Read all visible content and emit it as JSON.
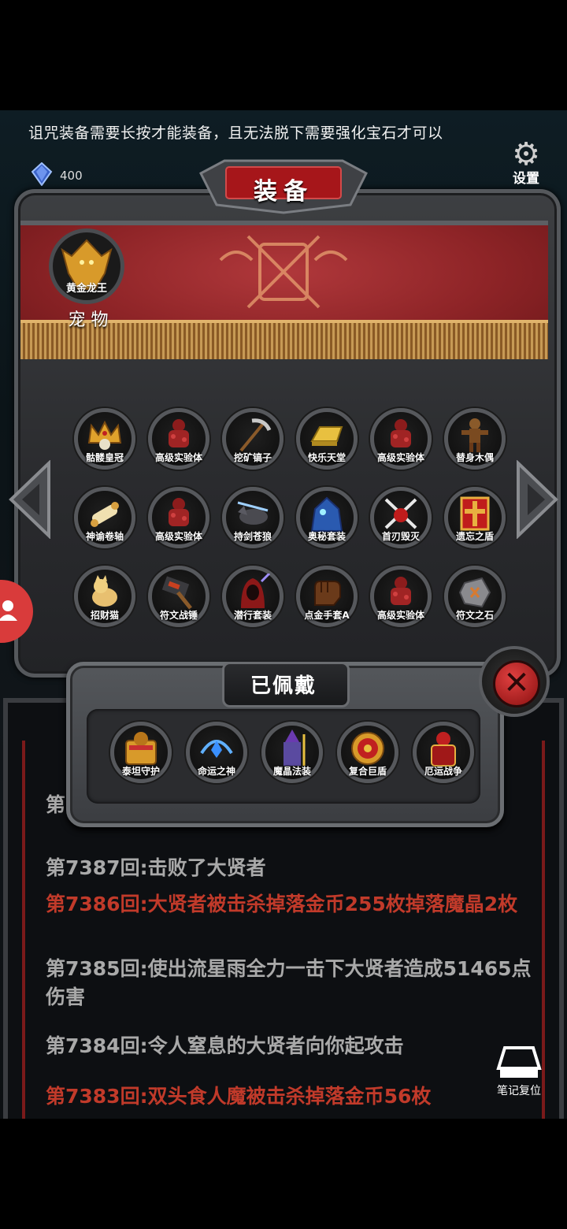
{
  "tip": "诅咒装备需要长按才能装备，且无法脱下需要强化宝石才可以",
  "gem_count": "400",
  "settings_label": "设置",
  "panel_title": "装备",
  "pet": {
    "name": "黄金龙王",
    "title": "宠 物"
  },
  "items": [
    {
      "name": "骷髅皇冠",
      "icon": "crown-icon"
    },
    {
      "name": "高级实验体",
      "icon": "golem-icon"
    },
    {
      "name": "挖矿镐子",
      "icon": "pickaxe-icon"
    },
    {
      "name": "快乐天堂",
      "icon": "gold-bar-icon"
    },
    {
      "name": "高级实验体",
      "icon": "golem-icon"
    },
    {
      "name": "替身木偶",
      "icon": "puppet-icon"
    },
    {
      "name": "神谕卷轴",
      "icon": "scroll-icon"
    },
    {
      "name": "高级实验体",
      "icon": "golem-icon"
    },
    {
      "name": "持剑苍狼",
      "icon": "wolf-icon"
    },
    {
      "name": "奥秘套装",
      "icon": "blue-robe-icon"
    },
    {
      "name": "首刃毁灭",
      "icon": "crossed-blades-icon"
    },
    {
      "name": "遗忘之盾",
      "icon": "red-shield-icon"
    },
    {
      "name": "招财猫",
      "icon": "cat-icon"
    },
    {
      "name": "符文战锤",
      "icon": "hammer-icon"
    },
    {
      "name": "潜行套装",
      "icon": "hood-icon"
    },
    {
      "name": "点金手套A",
      "icon": "glove-icon"
    },
    {
      "name": "高级实验体",
      "icon": "golem-icon"
    },
    {
      "name": "符文之石",
      "icon": "rune-stone-icon"
    }
  ],
  "equipped_title": "已佩戴",
  "equipped": [
    {
      "name": "泰坦守护",
      "icon": "titan-armor-icon"
    },
    {
      "name": "命运之神",
      "icon": "fate-amulet-icon"
    },
    {
      "name": "魔晶法装",
      "icon": "wizard-icon"
    },
    {
      "name": "复合巨盾",
      "icon": "round-shield-icon"
    },
    {
      "name": "厄运战争",
      "icon": "red-knight-icon"
    }
  ],
  "log_partial": "第",
  "log": [
    {
      "text": "第7387回:击败了大贤者",
      "color": "gray"
    },
    {
      "text": "第7386回:大贤者被击杀掉落金币255枚掉落魔晶2枚",
      "color": "red"
    },
    {
      "text": "第7385回:使出流星雨全力一击下大贤者造成51465点伤害",
      "color": "gray"
    },
    {
      "text": "第7384回:令人窒息的大贤者向你起攻击",
      "color": "gray"
    },
    {
      "text": "第7383回:双头食人魔被击杀掉落金币56枚",
      "color": "red"
    }
  ],
  "note_reset_label": "笔记复位"
}
